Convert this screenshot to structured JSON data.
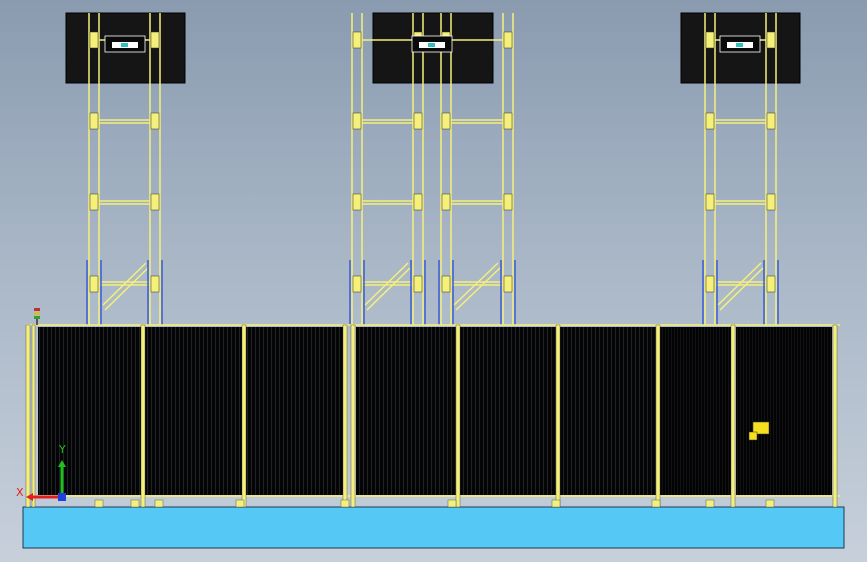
{
  "viewport": {
    "background_top": "#8a9bb0",
    "background_bottom": "#c7d0db"
  },
  "triad": {
    "x_label": "X",
    "y_label": "Y",
    "x_color": "#e02020",
    "y_color": "#20c020",
    "z_color": "#2040e0"
  },
  "colors": {
    "base_fill": "#55c8f6",
    "frame_yellow": "#f5f07a",
    "guard_black": "#050505",
    "monitor_black": "#151515",
    "blue_post": "#3a5bd8"
  },
  "model": {
    "towers": [
      "tower-left",
      "tower-middle",
      "tower-right"
    ],
    "guard_panels": 8
  }
}
